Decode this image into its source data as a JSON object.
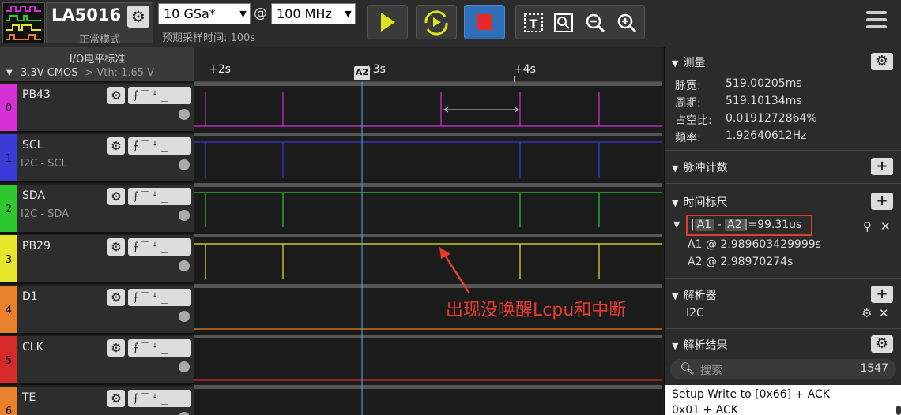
{
  "toolbar": {
    "device_name": "LA5016",
    "mode": "正常模式",
    "sample_rate": "10 GSa*",
    "at": "@",
    "sample_depth": "100 MHz",
    "expected_time": "预期采样时间: 100s"
  },
  "io": {
    "title": "I/O电平标准",
    "standard": "3.3V CMOS",
    "vth": "-> Vth: 1.65 V"
  },
  "channels": [
    {
      "num": "0",
      "name": "PB43",
      "sub": "",
      "color": "#d62fd6"
    },
    {
      "num": "1",
      "name": "SCL",
      "sub": "I2C - SCL",
      "color": "#3a3ad6"
    },
    {
      "num": "2",
      "name": "SDA",
      "sub": "I2C - SDA",
      "color": "#2ec82e"
    },
    {
      "num": "3",
      "name": "PB29",
      "sub": "",
      "color": "#e6e62a"
    },
    {
      "num": "4",
      "name": "D1",
      "sub": "",
      "color": "#e8812a"
    },
    {
      "num": "5",
      "name": "CLK",
      "sub": "",
      "color": "#d62a2a"
    },
    {
      "num": "6",
      "name": "TE",
      "sub": "",
      "color": "#e8812a"
    }
  ],
  "ruler": {
    "labels": [
      "+2s",
      "+3s",
      "+4s"
    ],
    "marker": "A2"
  },
  "annotation": "出现没唤醒Lcpu和中断",
  "measure": {
    "title": "测量",
    "items": [
      {
        "k": "脉宽:",
        "v": "519.00205ms"
      },
      {
        "k": "周期:",
        "v": "519.10134ms"
      },
      {
        "k": "占空比:",
        "v": "0.0191272864%"
      },
      {
        "k": "频率:",
        "v": "1.92640612Hz"
      }
    ]
  },
  "pulse_count": {
    "title": "脉冲计数"
  },
  "time_ruler": {
    "title": "时间标尺",
    "a1": "A1",
    "dash": "-",
    "a2": "A2",
    "delta": "|=99.31us",
    "a1_pos": "A1 @ 2.989603429999s",
    "a2_pos": "A2 @ 2.98970274s"
  },
  "decoder": {
    "title": "解析器",
    "item": "I2C"
  },
  "results": {
    "title": "解析结果",
    "search_placeholder": "搜索",
    "count": "1547",
    "rows": [
      "Setup Write to [0x66] + ACK",
      "0x01 + ACK"
    ]
  }
}
